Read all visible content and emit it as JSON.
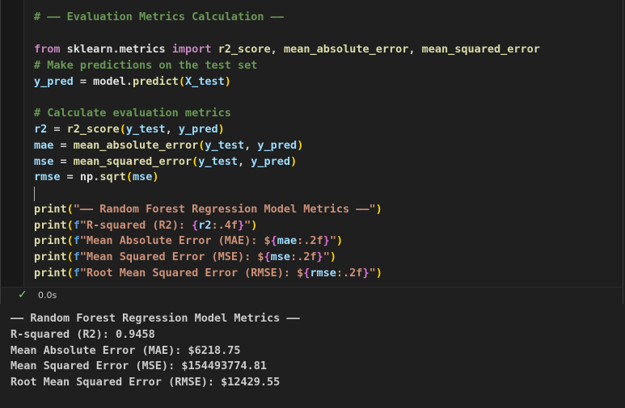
{
  "cell": {
    "code": [
      {
        "row": "comment_header",
        "parts": [
          [
            "cm",
            "# —— Evaluation Metrics Calculation ——"
          ]
        ]
      },
      {
        "row": "blank1",
        "parts": []
      },
      {
        "row": "import",
        "parts": [
          [
            "kw",
            "from"
          ],
          [
            "op",
            " "
          ],
          [
            "id",
            "sklearn.metrics"
          ],
          [
            "op",
            " "
          ],
          [
            "kw",
            "import"
          ],
          [
            "op",
            " "
          ],
          [
            "fn",
            "r2_score"
          ],
          [
            "op",
            ", "
          ],
          [
            "fn",
            "mean_absolute_error"
          ],
          [
            "op",
            ", "
          ],
          [
            "fn",
            "mean_squared_error"
          ]
        ]
      },
      {
        "row": "comment_predict",
        "parts": [
          [
            "cm",
            "# Make predictions on the test set"
          ]
        ]
      },
      {
        "row": "predict",
        "parts": [
          [
            "vr",
            "y_pred"
          ],
          [
            "op",
            " = "
          ],
          [
            "id",
            "model"
          ],
          [
            "op",
            "."
          ],
          [
            "fn",
            "predict"
          ],
          [
            "br1",
            "("
          ],
          [
            "vr",
            "X_test"
          ],
          [
            "br1",
            ")"
          ]
        ]
      },
      {
        "row": "blank2",
        "parts": []
      },
      {
        "row": "comment_calc",
        "parts": [
          [
            "cm",
            "# Calculate evaluation metrics"
          ]
        ]
      },
      {
        "row": "r2",
        "parts": [
          [
            "vr",
            "r2"
          ],
          [
            "op",
            " = "
          ],
          [
            "fn",
            "r2_score"
          ],
          [
            "br1",
            "("
          ],
          [
            "vr",
            "y_test"
          ],
          [
            "op",
            ", "
          ],
          [
            "vr",
            "y_pred"
          ],
          [
            "br1",
            ")"
          ]
        ]
      },
      {
        "row": "mae",
        "parts": [
          [
            "vr",
            "mae"
          ],
          [
            "op",
            " = "
          ],
          [
            "fn",
            "mean_absolute_error"
          ],
          [
            "br1",
            "("
          ],
          [
            "vr",
            "y_test"
          ],
          [
            "op",
            ", "
          ],
          [
            "vr",
            "y_pred"
          ],
          [
            "br1",
            ")"
          ]
        ]
      },
      {
        "row": "mse",
        "parts": [
          [
            "vr",
            "mse"
          ],
          [
            "op",
            " = "
          ],
          [
            "fn",
            "mean_squared_error"
          ],
          [
            "br1",
            "("
          ],
          [
            "vr",
            "y_test"
          ],
          [
            "op",
            ", "
          ],
          [
            "vr",
            "y_pred"
          ],
          [
            "br1",
            ")"
          ]
        ]
      },
      {
        "row": "rmse",
        "parts": [
          [
            "vr",
            "rmse"
          ],
          [
            "op",
            " = "
          ],
          [
            "id",
            "np"
          ],
          [
            "op",
            "."
          ],
          [
            "fn",
            "sqrt"
          ],
          [
            "br1",
            "("
          ],
          [
            "vr",
            "mse"
          ],
          [
            "br1",
            ")"
          ]
        ]
      },
      {
        "row": "blank3",
        "parts": []
      },
      {
        "row": "print_header",
        "parts": [
          [
            "fn",
            "print"
          ],
          [
            "br1",
            "("
          ],
          [
            "st",
            "\"—— Random Forest Regression Model Metrics ——\""
          ],
          [
            "br1",
            ")"
          ]
        ]
      },
      {
        "row": "print_r2",
        "parts": [
          [
            "fn",
            "print"
          ],
          [
            "br1",
            "("
          ],
          [
            "pf",
            "f"
          ],
          [
            "st",
            "\"R-squared (R2): "
          ],
          [
            "br2",
            "{"
          ],
          [
            "vr",
            "r2"
          ],
          [
            "st",
            ":.4f"
          ],
          [
            "br2",
            "}"
          ],
          [
            "st",
            "\""
          ],
          [
            "br1",
            ")"
          ]
        ]
      },
      {
        "row": "print_mae",
        "parts": [
          [
            "fn",
            "print"
          ],
          [
            "br1",
            "("
          ],
          [
            "pf",
            "f"
          ],
          [
            "st",
            "\"Mean Absolute Error (MAE): $"
          ],
          [
            "br2",
            "{"
          ],
          [
            "vr",
            "mae"
          ],
          [
            "st",
            ":.2f"
          ],
          [
            "br2",
            "}"
          ],
          [
            "st",
            "\""
          ],
          [
            "br1",
            ")"
          ]
        ]
      },
      {
        "row": "print_mse",
        "parts": [
          [
            "fn",
            "print"
          ],
          [
            "br1",
            "("
          ],
          [
            "pf",
            "f"
          ],
          [
            "st",
            "\"Mean Squared Error (MSE): $"
          ],
          [
            "br2",
            "{"
          ],
          [
            "vr",
            "mse"
          ],
          [
            "st",
            ":.2f"
          ],
          [
            "br2",
            "}"
          ],
          [
            "st",
            "\""
          ],
          [
            "br1",
            ")"
          ]
        ]
      },
      {
        "row": "print_rmse",
        "parts": [
          [
            "fn",
            "print"
          ],
          [
            "br1",
            "("
          ],
          [
            "pf",
            "f"
          ],
          [
            "st",
            "\"Root Mean Squared Error (RMSE): $"
          ],
          [
            "br2",
            "{"
          ],
          [
            "vr",
            "rmse"
          ],
          [
            "st",
            ":.2f"
          ],
          [
            "br2",
            "}"
          ],
          [
            "st",
            "\""
          ],
          [
            "br1",
            ")"
          ]
        ]
      }
    ],
    "status": {
      "check_icon": "check-icon",
      "execution_time": "0.0s"
    }
  },
  "output": {
    "lines": [
      "—— Random Forest Regression Model Metrics ——",
      "R-squared (R2): 0.9458",
      "Mean Absolute Error (MAE): $6218.75",
      "Mean Squared Error (MSE): $154493774.81",
      "Root Mean Squared Error (RMSE): $12429.55"
    ]
  },
  "colors": {
    "background": "#1f1f1f",
    "comment": "#6a9955",
    "keyword": "#c586c0",
    "function": "#dcdcaa",
    "variable": "#9cdcfe",
    "string": "#ce9178",
    "bracket_level1": "#ffd700",
    "bracket_level2": "#da70d6",
    "success_check": "#89d185"
  }
}
